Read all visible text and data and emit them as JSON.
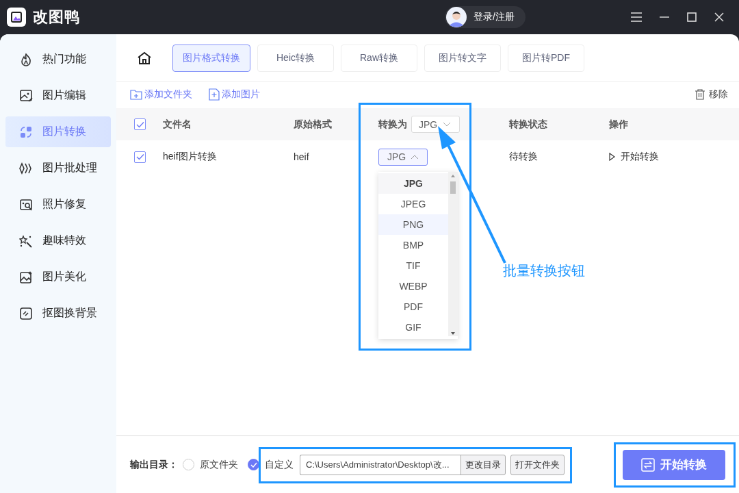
{
  "app": {
    "title": "改图鸭"
  },
  "account": {
    "label": "登录/注册"
  },
  "sidebar": {
    "items": [
      {
        "label": "热门功能",
        "selected": false
      },
      {
        "label": "图片编辑",
        "selected": false
      },
      {
        "label": "图片转换",
        "selected": true
      },
      {
        "label": "图片批处理",
        "selected": false
      },
      {
        "label": "照片修复",
        "selected": false
      },
      {
        "label": "趣味特效",
        "selected": false
      },
      {
        "label": "图片美化",
        "selected": false
      },
      {
        "label": "抠图换背景",
        "selected": false
      }
    ]
  },
  "tabs": [
    {
      "label": "图片格式转换",
      "selected": true
    },
    {
      "label": "Heic转换",
      "selected": false
    },
    {
      "label": "Raw转换",
      "selected": false
    },
    {
      "label": "图片转文字",
      "selected": false
    },
    {
      "label": "图片转PDF",
      "selected": false
    }
  ],
  "toolbar": {
    "add_folder": "添加文件夹",
    "add_image": "添加图片",
    "remove": "移除"
  },
  "table": {
    "header": {
      "checked": true,
      "name": "文件名",
      "format": "原始格式",
      "convert_label": "转换为",
      "convert_value": "JPG",
      "status": "转换状态",
      "action": "操作"
    },
    "rows": [
      {
        "checked": true,
        "name": "heif图片转换",
        "format": "heif",
        "target": "JPG",
        "expanded": true,
        "status": "待转换",
        "action": "开始转换"
      }
    ]
  },
  "dropdown": {
    "options": [
      {
        "label": "JPG",
        "selected": true,
        "highlighted": false
      },
      {
        "label": "JPEG",
        "selected": false,
        "highlighted": false
      },
      {
        "label": "PNG",
        "selected": false,
        "highlighted": true
      },
      {
        "label": "BMP",
        "selected": false,
        "highlighted": false
      },
      {
        "label": "TIF",
        "selected": false,
        "highlighted": false
      },
      {
        "label": "WEBP",
        "selected": false,
        "highlighted": false
      },
      {
        "label": "PDF",
        "selected": false,
        "highlighted": false
      },
      {
        "label": "GIF",
        "selected": false,
        "highlighted": false
      }
    ]
  },
  "output": {
    "label": "输出目录：",
    "options": [
      {
        "label": "原文件夹",
        "selected": false
      },
      {
        "label": "自定义",
        "selected": true
      }
    ],
    "path": "C:\\Users\\Administrator\\Desktop\\改...",
    "change": "更改目录",
    "open": "打开文件夹"
  },
  "start_button": "开始转换",
  "annotation": {
    "label": "批量转换按钮"
  }
}
